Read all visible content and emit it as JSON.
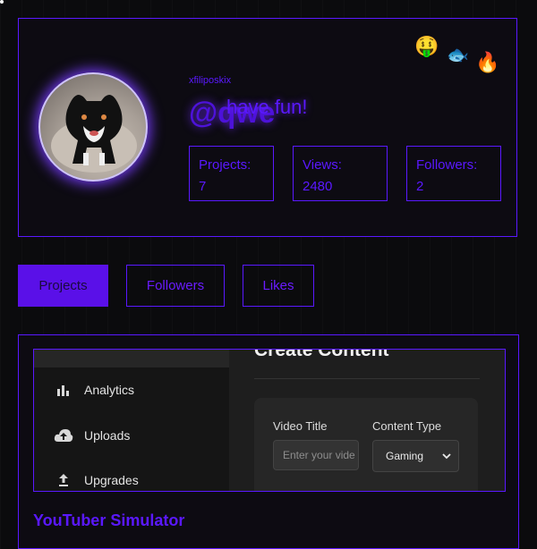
{
  "profile": {
    "username": "xfiliposkix",
    "handle": "@qwe",
    "tagline": "have fun!",
    "avatar_alt": "cat-avatar",
    "badges": [
      "money-face-emoji",
      "fish-emoji",
      "fire-emoji"
    ],
    "stats": [
      {
        "label": "Projects:",
        "value": "7"
      },
      {
        "label": "Views:",
        "value": "2480"
      },
      {
        "label": "Followers:",
        "value": "2"
      }
    ]
  },
  "tabs": [
    {
      "label": "Projects",
      "active": true
    },
    {
      "label": "Followers",
      "active": false
    },
    {
      "label": "Likes",
      "active": false
    }
  ],
  "project": {
    "title": "YouTuber Simulator",
    "screenshot": {
      "nav": [
        {
          "label": "Analytics",
          "icon": "bar-chart-icon"
        },
        {
          "label": "Uploads",
          "icon": "cloud-upload-icon"
        },
        {
          "label": "Upgrades",
          "icon": "upload-arrow-icon"
        }
      ],
      "heading": "Create Content",
      "video_title_label": "Video Title",
      "video_title_placeholder": "Enter your vide",
      "content_type_label": "Content Type",
      "content_type_value": "Gaming"
    }
  },
  "colors": {
    "accent": "#5a18ff",
    "background": "#0b0b0d",
    "active_tab": "#5a10e8"
  }
}
